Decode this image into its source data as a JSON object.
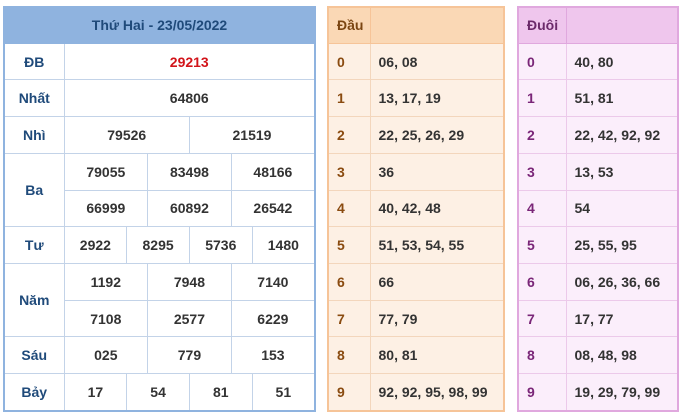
{
  "header": {
    "title": "Thứ Hai - 23/05/2022"
  },
  "results": {
    "db_label": "ĐB",
    "db_value": "29213",
    "nhat_label": "Nhất",
    "nhat_value": "64806",
    "nhi_label": "Nhì",
    "nhi_values": [
      "79526",
      "21519"
    ],
    "ba_label": "Ba",
    "ba_values": [
      "79055",
      "83498",
      "48166",
      "66999",
      "60892",
      "26542"
    ],
    "tu_label": "Tư",
    "tu_values": [
      "2922",
      "8295",
      "5736",
      "1480"
    ],
    "nam_label": "Năm",
    "nam_values": [
      "1192",
      "7948",
      "7140",
      "7108",
      "2577",
      "6229"
    ],
    "sau_label": "Sáu",
    "sau_values": [
      "025",
      "779",
      "153"
    ],
    "bay_label": "Bảy",
    "bay_values": [
      "17",
      "54",
      "81",
      "51"
    ]
  },
  "dau": {
    "header": "Đầu",
    "rows": [
      {
        "idx": "0",
        "vals": "06, 08"
      },
      {
        "idx": "1",
        "vals": "13, 17, 19"
      },
      {
        "idx": "2",
        "vals": "22, 25, 26, 29"
      },
      {
        "idx": "3",
        "vals": "36"
      },
      {
        "idx": "4",
        "vals": "40, 42, 48"
      },
      {
        "idx": "5",
        "vals": "51, 53, 54, 55"
      },
      {
        "idx": "6",
        "vals": "66"
      },
      {
        "idx": "7",
        "vals": "77, 79"
      },
      {
        "idx": "8",
        "vals": "80, 81"
      },
      {
        "idx": "9",
        "vals": "92, 92, 95, 98, 99"
      }
    ]
  },
  "duoi": {
    "header": "Đuôi",
    "rows": [
      {
        "idx": "0",
        "vals": "40, 80"
      },
      {
        "idx": "1",
        "vals": "51, 81"
      },
      {
        "idx": "2",
        "vals": "22, 42, 92, 92"
      },
      {
        "idx": "3",
        "vals": "13, 53"
      },
      {
        "idx": "4",
        "vals": "54"
      },
      {
        "idx": "5",
        "vals": "25, 55, 95"
      },
      {
        "idx": "6",
        "vals": "06, 26, 36, 66"
      },
      {
        "idx": "7",
        "vals": "17, 77"
      },
      {
        "idx": "8",
        "vals": "08, 48, 98"
      },
      {
        "idx": "9",
        "vals": "19, 29, 79, 99"
      }
    ]
  },
  "colors": {
    "special_prize": "#d2141a",
    "results_header": "#8fb3df",
    "dau_header": "#fad8b5",
    "duoi_header": "#efc6ed"
  }
}
